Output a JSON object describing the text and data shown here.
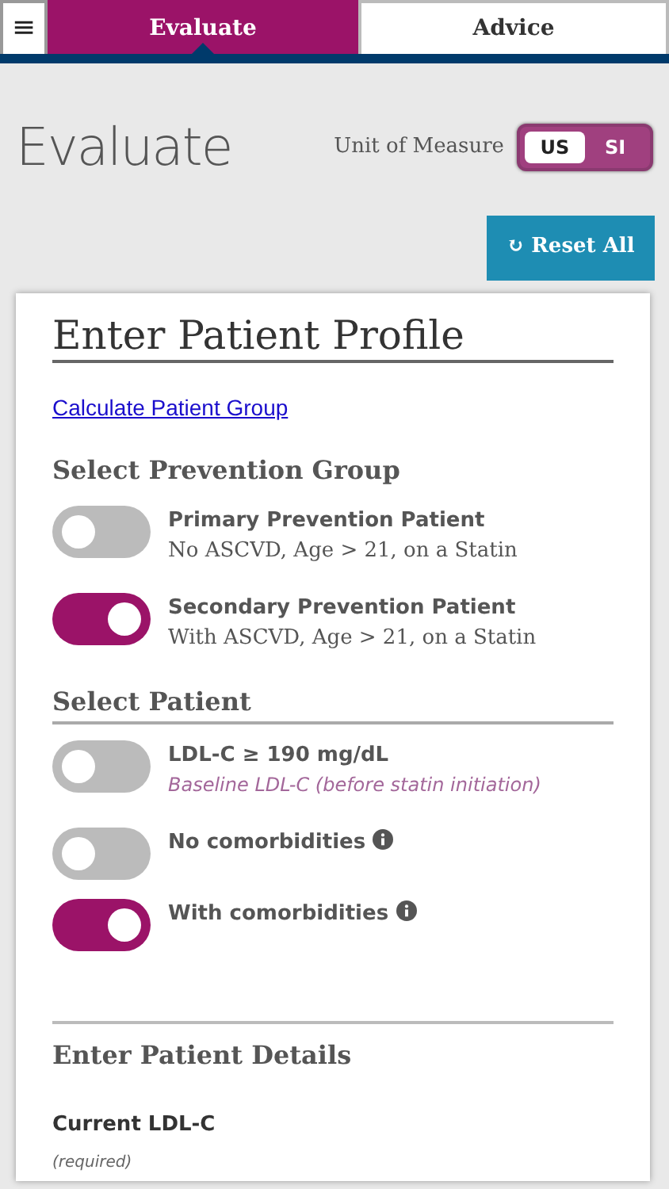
{
  "nav": {
    "menu_icon": "≡",
    "tabs": [
      {
        "label": "Evaluate",
        "selected": true
      },
      {
        "label": "Advice",
        "selected": false
      }
    ]
  },
  "page_title": "Evaluate",
  "unit_of_measure": {
    "label": "Unit of Measure",
    "options": [
      {
        "label": "US",
        "selected": true
      },
      {
        "label": "SI",
        "selected": false
      }
    ]
  },
  "reset_button": {
    "icon": "↻",
    "label": "Reset All"
  },
  "profile": {
    "title": "Enter Patient Profile",
    "link": "Calculate Patient Group",
    "sections": [
      {
        "title": "Select Prevention Group",
        "underline": false,
        "items": [
          {
            "label": "Primary Prevention Patient",
            "sub": "No ASCVD, Age > 21, on a Statin",
            "on": false,
            "info": false
          },
          {
            "label": "Secondary Prevention Patient",
            "sub": "With ASCVD, Age > 21, on a Statin",
            "on": true,
            "info": false
          }
        ]
      },
      {
        "title": "Select Patient",
        "underline": true,
        "items": [
          {
            "label": "LDL-C ≥ 190 mg/dL",
            "note": "Baseline LDL-C (before statin initiation)",
            "on": false,
            "info": false
          },
          {
            "label": "No comorbidities",
            "on": false,
            "info": true
          },
          {
            "label": "With comorbidities",
            "on": true,
            "info": true
          }
        ]
      }
    ],
    "details_title": "Enter Patient Details",
    "field": {
      "label": "Current LDL-C",
      "hint": "(required)"
    }
  }
}
